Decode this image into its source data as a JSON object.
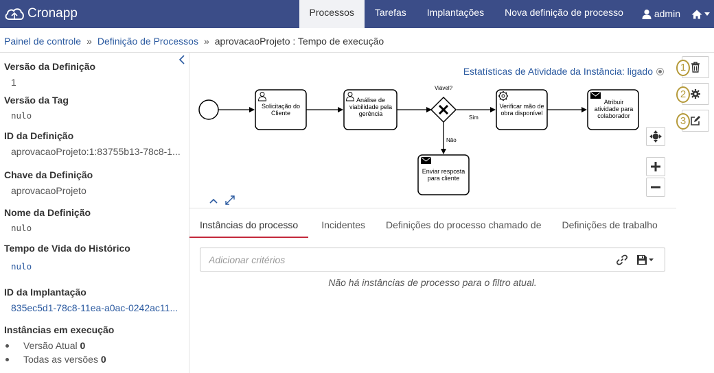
{
  "app": {
    "brand": "Cronapp"
  },
  "nav": {
    "items": [
      {
        "label": "Processos",
        "active": true
      },
      {
        "label": "Tarefas"
      },
      {
        "label": "Implantações"
      },
      {
        "label": "Nova definição de processo"
      }
    ],
    "user": "admin"
  },
  "breadcrumb": {
    "items": [
      "Painel de controle",
      "Definição de Processos"
    ],
    "separator": "»",
    "current": "aprovacaoProjeto : Tempo de execução"
  },
  "sidebar": {
    "props": [
      {
        "label": "Versão da Definição",
        "value": "1"
      },
      {
        "label": "Versão da Tag",
        "value": "nulo"
      },
      {
        "label": "ID da Definição",
        "value": "aprovacaoProjeto:1:83755b13-78c8-1..."
      },
      {
        "label": "Chave da Definição",
        "value": "aprovacaoProjeto"
      },
      {
        "label": "Nome da Definição",
        "value": "nulo"
      },
      {
        "label": "Tempo de Vida do Histórico",
        "value": "nulo"
      },
      {
        "label": "ID da Implantação",
        "value": "835ec5d1-78c8-11ea-a0ac-0242ac11..."
      }
    ],
    "running": {
      "label": "Instâncias em execução",
      "items": [
        {
          "label": "Versão Atual",
          "count": "0"
        },
        {
          "label": "Todas as versões",
          "count": "0"
        }
      ]
    }
  },
  "diagram": {
    "stats_label": "Estatísticas de Atividade da Instância: ligado",
    "tasks": {
      "t1": [
        "Solicitação do",
        "Cliente"
      ],
      "t2": [
        "Análise de",
        "viabilidade pela",
        "gerência"
      ],
      "t3": [
        "Verificar mão de",
        "obra disponível"
      ],
      "t4": [
        "Atribuir",
        "atividade para",
        "colaborador"
      ],
      "t5": [
        "Enviar resposta",
        "para cliente"
      ]
    },
    "gateway": "Viável?",
    "flow_yes": "Sim",
    "flow_no": "Não"
  },
  "actions": {
    "numbers": [
      "1",
      "2",
      "3"
    ]
  },
  "tabs": [
    {
      "label": "Instâncias do processo",
      "active": true
    },
    {
      "label": "Incidentes"
    },
    {
      "label": "Definições do processo chamado de"
    },
    {
      "label": "Definições de trabalho"
    }
  ],
  "search": {
    "placeholder": "Adicionar critérios"
  },
  "empty_message": "Não há instâncias de processo para o filtro atual.",
  "colors": {
    "navbar": "#3b4d88",
    "link": "#2b5aa0",
    "tab_active": "#c3283a",
    "step_number": "#b59a3a"
  }
}
